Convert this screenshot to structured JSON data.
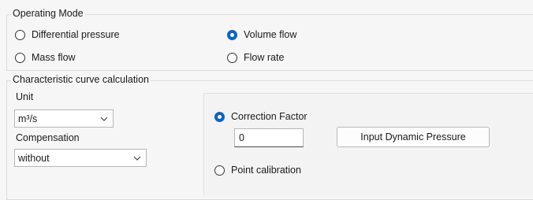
{
  "operating_mode": {
    "title": "Operating Mode",
    "options": [
      {
        "label": "Differential pressure",
        "checked": false
      },
      {
        "label": "Volume flow",
        "checked": true
      },
      {
        "label": "Mass flow",
        "checked": false
      },
      {
        "label": "Flow rate",
        "checked": false
      }
    ]
  },
  "curve": {
    "title": "Characteristic curve calculation",
    "unit_label": "Unit",
    "unit_value": "m³/s",
    "compensation_label": "Compensation",
    "compensation_value": "without",
    "correction_factor_label": "Correction Factor",
    "correction_factor_checked": true,
    "correction_factor_value": "0",
    "input_dynamic_pressure_label": "Input Dynamic Pressure",
    "point_calibration_label": "Point calibration",
    "point_calibration_checked": false
  },
  "icons": {
    "dropdown": "chevron-down-icon"
  }
}
